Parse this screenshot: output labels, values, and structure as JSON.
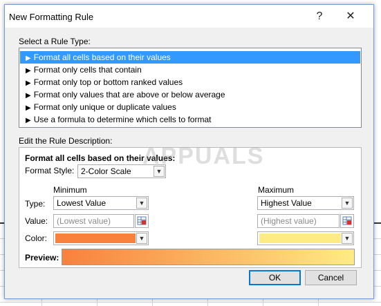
{
  "window": {
    "title": "New Formatting Rule",
    "help_glyph": "?",
    "close_glyph": "✕"
  },
  "rule_type": {
    "label": "Select a Rule Type:",
    "items": [
      "Format all cells based on their values",
      "Format only cells that contain",
      "Format only top or bottom ranked values",
      "Format only values that are above or below average",
      "Format only unique or duplicate values",
      "Use a formula to determine which cells to format"
    ],
    "selected_index": 0
  },
  "description": {
    "label": "Edit the Rule Description:",
    "heading": "Format all cells based on their values:",
    "format_style_label": "Format Style:",
    "format_style_value": "2-Color Scale",
    "minimum_label": "Minimum",
    "maximum_label": "Maximum",
    "type_label": "Type:",
    "value_label": "Value:",
    "color_label": "Color:",
    "min_type": "Lowest Value",
    "max_type": "Highest Value",
    "min_value_placeholder": "(Lowest value)",
    "max_value_placeholder": "(Highest value)",
    "min_color": "#f8813e",
    "max_color": "#ffeb84",
    "preview_label": "Preview:"
  },
  "buttons": {
    "ok": "OK",
    "cancel": "Cancel"
  },
  "watermark": "APPUALS",
  "colors": {
    "selection": "#3399ff",
    "window_border": "#6f9ed6"
  }
}
